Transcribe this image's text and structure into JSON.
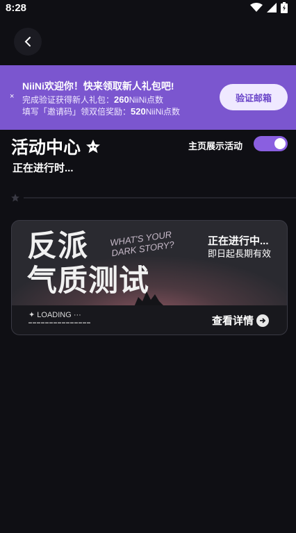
{
  "status_bar": {
    "time": "8:28"
  },
  "banner": {
    "title": "NiiNi欢迎你！快来领取新人礼包吧!",
    "line1_prefix": "完成验证获得新人礼包：",
    "line1_value": "260",
    "line1_suffix": "NiiNi点数",
    "line2_prefix": "填写「邀请码」领双倍奖励：",
    "line2_value": "520",
    "line2_suffix": "NiiNi点数",
    "close_label": "×",
    "verify_button": "验证邮箱"
  },
  "page": {
    "title": "活动中心",
    "subtitle": "正在进行时...",
    "toggle_label": "主页展示活动",
    "toggle_on": true
  },
  "activity_card": {
    "art_title_line1": "反派",
    "art_title_line2": "气质测试",
    "art_script_line1": "WHAT'S YOUR",
    "art_script_line2": "DARK STORY?",
    "status": "正在进行中...",
    "duration": "即日起長期有效",
    "loading_text": "✦ LOADING ···",
    "details_label": "查看详情"
  },
  "colors": {
    "background": "#0f0f14",
    "banner": "#7b56cf",
    "toggle": "#8a5fe0",
    "verify_button_bg": "#efe9ff"
  }
}
